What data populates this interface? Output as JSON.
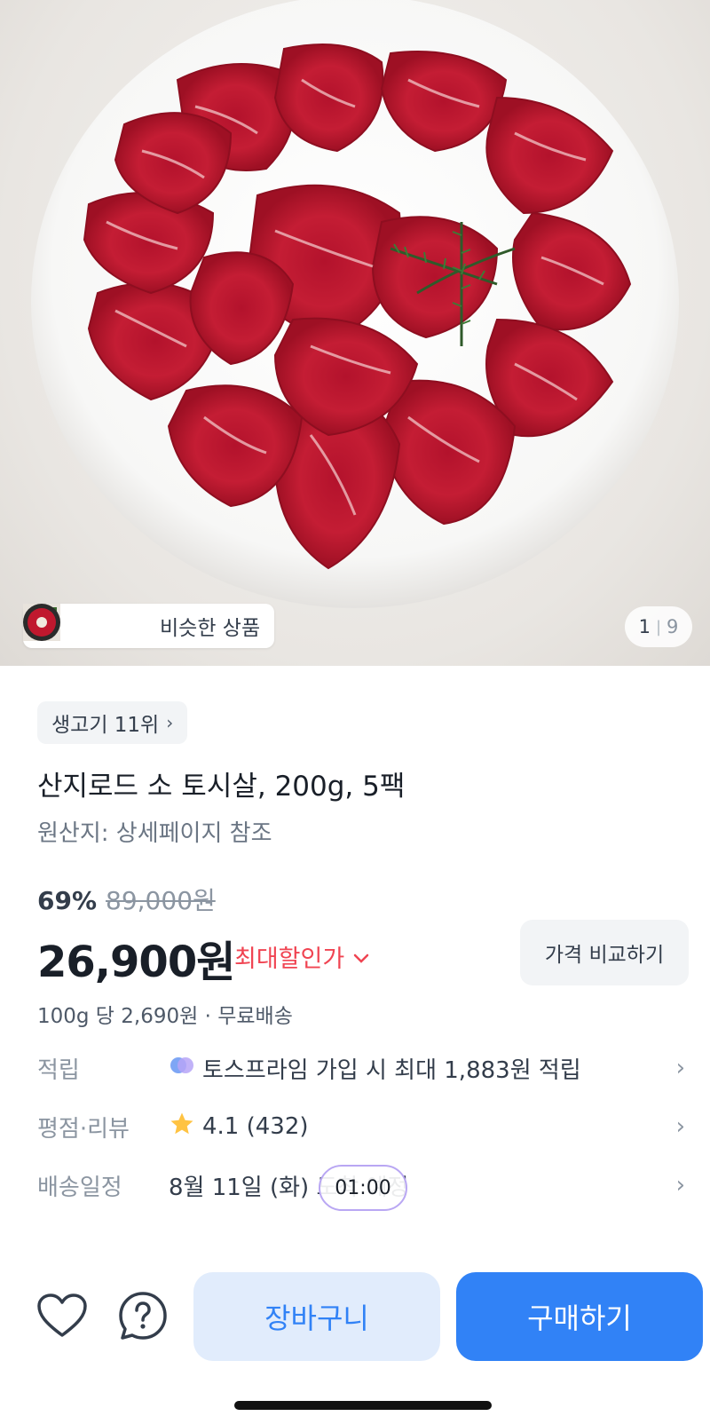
{
  "hero": {
    "similar_label": "비슷한 상품",
    "page_current": "1",
    "page_total": "9"
  },
  "rank": {
    "label": "생고기 11위",
    "chevron": "›"
  },
  "product": {
    "title": "산지로드 소 토시살, 200g, 5팩",
    "origin": "원산지: 상세페이지 참조",
    "discount_pct": "69%",
    "original_price": "89,000원",
    "price": "26,900원",
    "max_discount_label": "최대할인가",
    "compare_label": "가격 비교하기",
    "unit_price": "100g 당 2,690원 · 무료배송"
  },
  "info_rows": [
    {
      "key": "적립",
      "value": "토스프라임 가입 시 최대 1,883원 적립",
      "icon": "toss-prime-icon"
    },
    {
      "key": "평점·리뷰",
      "value": "4.1 (432)",
      "icon": "star-icon"
    },
    {
      "key": "배송일정",
      "value": "8월 11일 (화) 도착 예정",
      "icon": ""
    }
  ],
  "timer": "01:00",
  "actions": {
    "cart_label": "장바구니",
    "buy_label": "구매하기"
  },
  "colors": {
    "accent": "#3182f6",
    "accent_light": "#e1ecfc",
    "discount_red": "#f04452",
    "star": "#ffc342"
  }
}
